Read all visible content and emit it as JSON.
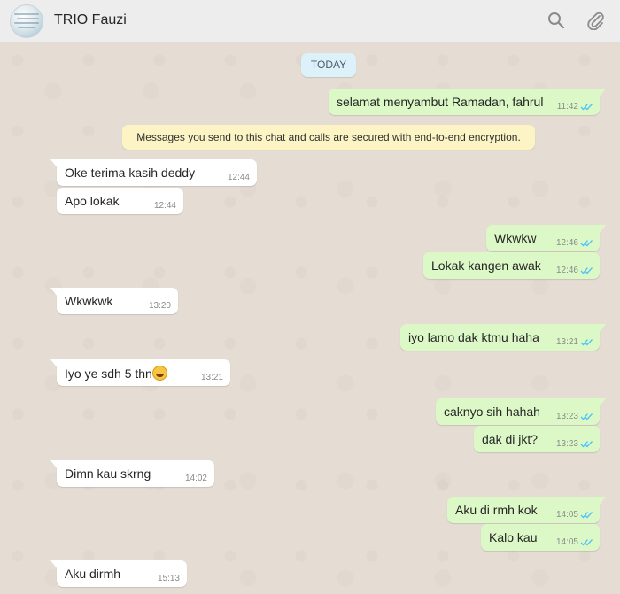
{
  "header": {
    "title": "TRIO Fauzi",
    "icons": [
      "search-icon",
      "paperclip-icon"
    ]
  },
  "chat": {
    "date_label": "TODAY",
    "encryption_notice": "Messages you send to this chat and calls are secured with end-to-end encryption.",
    "messages": [
      {
        "dir": "out",
        "text": "selamat menyambut Ramadan, fahrul",
        "time": "11:42",
        "ticks": "read"
      },
      {
        "dir": "in",
        "text": "Oke terima kasih deddy",
        "time": "12:44"
      },
      {
        "dir": "in",
        "text": "Apo lokak",
        "time": "12:44"
      },
      {
        "dir": "out",
        "text": "Wkwkw",
        "time": "12:46",
        "ticks": "read"
      },
      {
        "dir": "out",
        "text": "Lokak kangen awak",
        "time": "12:46",
        "ticks": "read"
      },
      {
        "dir": "in",
        "text": "Wkwkwk",
        "time": "13:20"
      },
      {
        "dir": "out",
        "text": "iyo lamo dak ktmu haha",
        "time": "13:21",
        "ticks": "read"
      },
      {
        "dir": "in",
        "text": "Iyo ye sdh 5 thn",
        "emoji": "rolling-on-floor-laughing-emoji",
        "time": "13:21"
      },
      {
        "dir": "out",
        "text": "caknyo sih hahah",
        "time": "13:23",
        "ticks": "read"
      },
      {
        "dir": "out",
        "text": "dak di jkt?",
        "time": "13:23",
        "ticks": "read"
      },
      {
        "dir": "in",
        "text": "Dimn kau skrng",
        "time": "14:02"
      },
      {
        "dir": "out",
        "text": "Aku di rmh kok",
        "time": "14:05",
        "ticks": "read"
      },
      {
        "dir": "out",
        "text": "Kalo kau",
        "time": "14:05",
        "ticks": "read"
      },
      {
        "dir": "in",
        "text": "Aku dirmh",
        "time": "15:13"
      }
    ]
  },
  "colors": {
    "header_bg": "#ededed",
    "chat_bg": "#e5ddd3",
    "incoming_bubble": "#ffffff",
    "outgoing_bubble": "#dcf8c6",
    "read_ticks": "#4fc3f7",
    "date_pill": "#dcf1fa",
    "notice_bg": "#fdf4c5"
  }
}
